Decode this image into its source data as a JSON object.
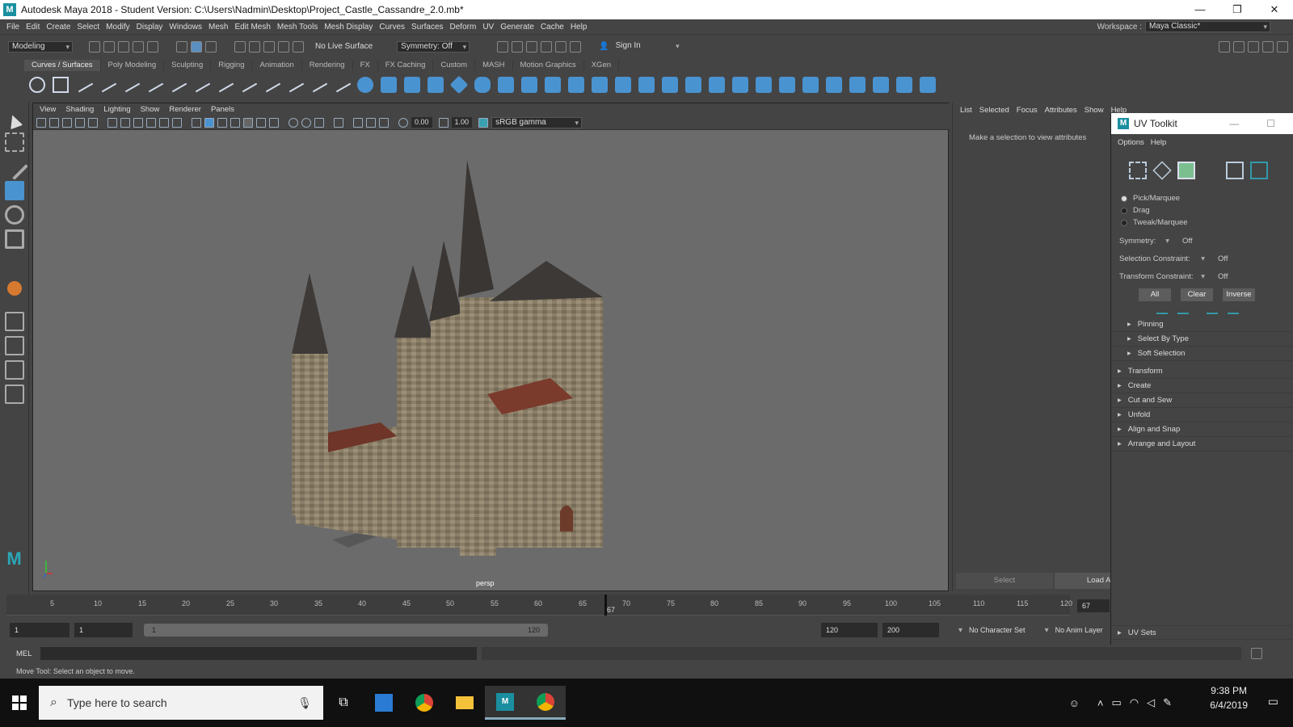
{
  "window": {
    "title": "Autodesk Maya 2018 - Student Version: C:\\Users\\Nadmin\\Desktop\\Project_Castle_Cassandre_2.0.mb*",
    "logo": "M"
  },
  "menubar": {
    "items": [
      "File",
      "Edit",
      "Create",
      "Select",
      "Modify",
      "Display",
      "Windows",
      "Mesh",
      "Edit Mesh",
      "Mesh Tools",
      "Mesh Display",
      "Curves",
      "Surfaces",
      "Deform",
      "UV",
      "Generate",
      "Cache",
      "Help"
    ],
    "workspace_label": "Workspace :",
    "workspace_value": "Maya Classic*"
  },
  "statusline": {
    "mode": "Modeling",
    "live_surface": "No Live Surface",
    "symmetry": "Symmetry: Off",
    "sign_in": "Sign In"
  },
  "shelf": {
    "tabs": [
      "Curves / Surfaces",
      "Poly Modeling",
      "Sculpting",
      "Rigging",
      "Animation",
      "Rendering",
      "FX",
      "FX Caching",
      "Custom",
      "MASH",
      "Motion Graphics",
      "XGen"
    ],
    "active_tab": "Curves / Surfaces"
  },
  "viewport": {
    "menu": [
      "View",
      "Shading",
      "Lighting",
      "Show",
      "Renderer",
      "Panels"
    ],
    "exposure": "0.00",
    "gamma": "1.00",
    "color_space": "sRGB gamma",
    "camera": "persp"
  },
  "attribute_editor": {
    "tabs": [
      "List",
      "Selected",
      "Focus",
      "Attributes",
      "Show",
      "Help"
    ],
    "message": "Make a selection to view attributes",
    "select_button": "Select",
    "load_button": "Load Attri"
  },
  "uv_toolkit": {
    "title": "UV Toolkit",
    "menu": [
      "Options",
      "Help"
    ],
    "modes": [
      "Pick/Marquee",
      "Drag",
      "Tweak/Marquee"
    ],
    "symmetry_label": "Symmetry:",
    "symmetry_value": "Off",
    "selection_constraint_label": "Selection Constraint:",
    "selection_constraint_value": "Off",
    "transform_constraint_label": "Transform Constraint:",
    "transform_constraint_value": "Off",
    "buttons": [
      "All",
      "Clear",
      "Inverse"
    ],
    "subsections": [
      "Pinning",
      "Select By Type",
      "Soft Selection"
    ],
    "sections": [
      "Transform",
      "Create",
      "Cut and Sew",
      "Unfold",
      "Align and Snap",
      "Arrange and Layout"
    ],
    "uv_sets": "UV Sets"
  },
  "timeline": {
    "ticks": [
      "5",
      "10",
      "15",
      "20",
      "25",
      "30",
      "35",
      "40",
      "45",
      "50",
      "55",
      "60",
      "65",
      "70",
      "75",
      "80",
      "85",
      "90",
      "95",
      "100",
      "105",
      "110",
      "115",
      "120"
    ],
    "current_frame": "67",
    "current_frame_field": "67"
  },
  "range": {
    "start": "1",
    "playback_start": "1",
    "slider_start": "1",
    "slider_end": "120",
    "playback_end": "120",
    "end": "200",
    "character_set": "No Character Set",
    "anim_layer": "No Anim Layer"
  },
  "command_line": {
    "label": "MEL"
  },
  "help_line": "Move Tool: Select an object to move.",
  "taskbar": {
    "search_placeholder": "Type here to search",
    "time": "9:38 PM",
    "date": "6/4/2019"
  }
}
